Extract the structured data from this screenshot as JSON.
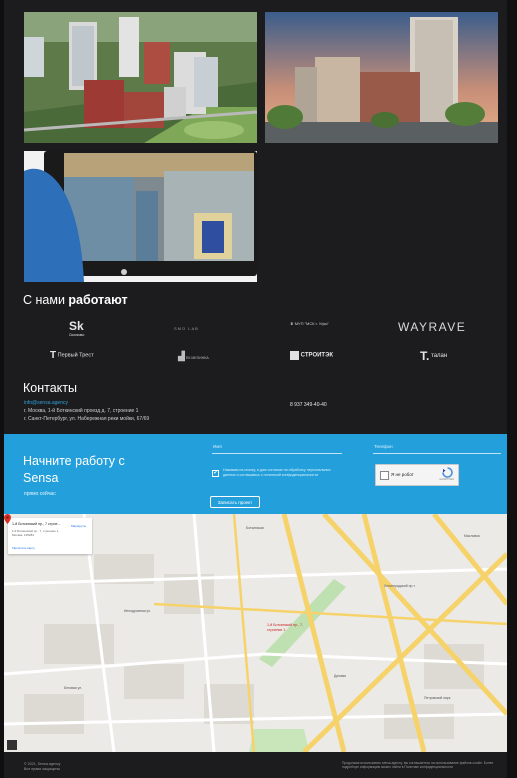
{
  "partners": {
    "title_prefix": "С нами",
    "title_bold": "работают",
    "logos": [
      {
        "big": "Sk",
        "small": "Сколково"
      },
      {
        "big": "SMO LAB",
        "small": ""
      },
      {
        "big": "МУП \"МСК г. Уфы\"",
        "small": ""
      },
      {
        "big": "WAYRAVE",
        "small": ""
      },
      {
        "big": "Первый Трест",
        "small": ""
      },
      {
        "big": "ЕК МЕЛИНКА",
        "small": ""
      },
      {
        "big": "СТРОИТЭК",
        "small": ""
      },
      {
        "big": "талан",
        "small": ""
      }
    ]
  },
  "contacts": {
    "title": "Контакты",
    "email": "info@sensa.agency",
    "address_1": "г. Москва, 1-й Боткинский проезд д. 7, строение 1",
    "address_2": "г. Санкт-Петербург, ул. Набережная реки мойки, 67/69",
    "phone": "8 937 349-40-40"
  },
  "cta": {
    "title": "Начните работу с Sensa",
    "subtitle": "прямо сейчас",
    "field_1_label": "Имя",
    "field_2_label": "Телефон",
    "checked": "✔",
    "consent_text": "Нажимая на кнопку, я даю согласие на обработку персональных данных и соглашаюсь с политикой конфиденциальности",
    "button_label": "Записать проект",
    "captcha_text": "Я не робот",
    "captcha_brand": "reCAPTCHA"
  },
  "map": {
    "card_name": "1-й Боткинский пр., 7 строе...",
    "card_address": "1-й Боткинский пр., 7, строение 1, Москва, 125284",
    "card_route": "Маршруты",
    "card_bigger": "Увеличить карту",
    "pin_label": "1-й Боткинский пр., 7, строение 1",
    "place_labels": [
      "Боткинская",
      "Ипподромная ул.",
      "Беговая ул.",
      "Ленинградский пр-т",
      "Динамо",
      "Петровский парк",
      "Масловка"
    ]
  },
  "footer": {
    "copyright": "© 2021, Sensa.agency",
    "rights": "Все права защищены",
    "cookie_text": "Продолжая использовать sensa.agency, вы соглашаетесь на использование файлов cookie. Более подробную информацию можно найти в Политике конфиденциальности"
  },
  "colors": {
    "background": "#1c1b1d",
    "accent": "#23a0dc",
    "map_bg": "#eceae6",
    "road": "#f6d36a"
  }
}
